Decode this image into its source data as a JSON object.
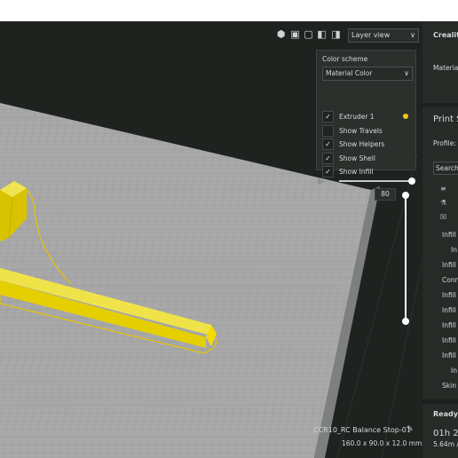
{
  "view_controls": {
    "icons": [
      "3d-view-icon",
      "front-view-icon",
      "top-view-icon",
      "left-view-icon",
      "right-view-icon"
    ],
    "view_select": "Layer view"
  },
  "color_panel": {
    "heading": "Color scheme",
    "scheme_select": "Material Color",
    "options": [
      {
        "label": "Extruder 1",
        "checked": true
      },
      {
        "label": "Show Travels",
        "checked": false
      },
      {
        "label": "Show Helpers",
        "checked": true
      },
      {
        "label": "Show Shell",
        "checked": true
      },
      {
        "label": "Show Infill",
        "checked": true
      }
    ],
    "extruder_color": "#f4c21b"
  },
  "layer_slider": {
    "current_layer": "80"
  },
  "model": {
    "name": "CCR10_RC Balance Stop-01",
    "dimensions": "160.0 x 90.0 x 12.0 mm"
  },
  "right_panel": {
    "printer": "Creality",
    "material_label": "Material",
    "print_settings_title": "Print S",
    "profile_label": "Profile:",
    "search_placeholder": "Search...",
    "settings_rows": [
      "Infill",
      "In",
      "Infill",
      "Conn",
      "Infill",
      "Infill",
      "Infill",
      "Infill",
      "Infill",
      "In",
      "Skin"
    ],
    "ready_label": "Ready t",
    "time_estimate": "01h 2",
    "material_estimate": "5.64m /"
  },
  "colors": {
    "background": "#1e2320",
    "build_plate": "#a6a6a6",
    "model_yellow": "#f4d100",
    "panel": "#2b302d"
  }
}
